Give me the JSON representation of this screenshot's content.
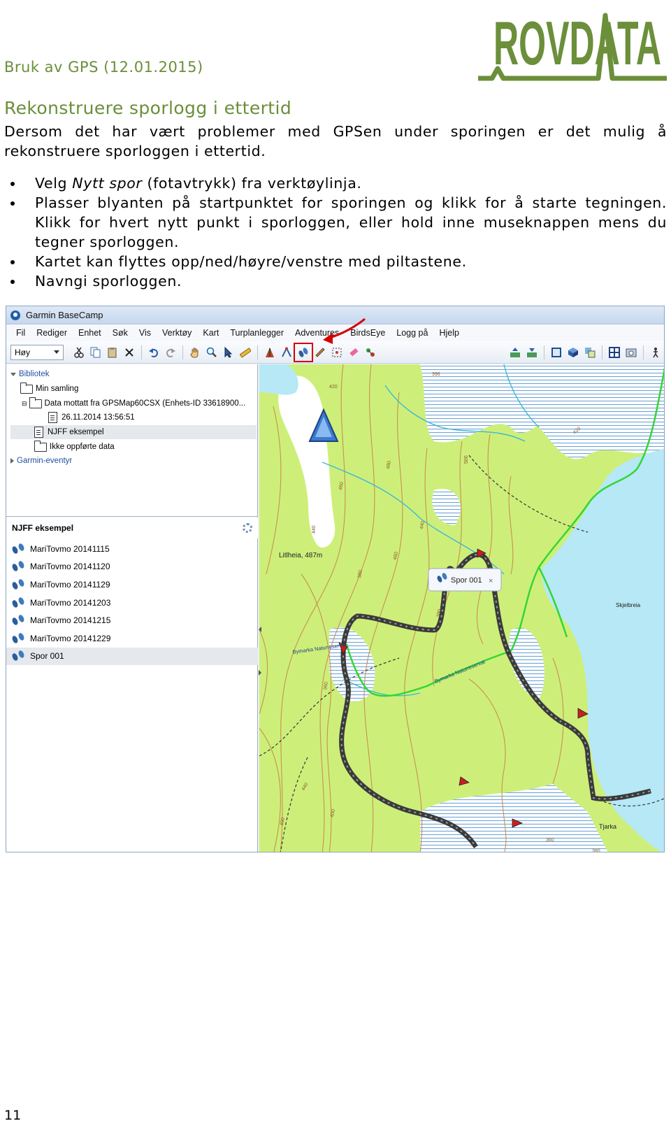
{
  "header": {
    "doc_title": "Bruk av GPS (12.01.2015)",
    "logo_text": "ROVDATA",
    "logo_color": "#6b8f3a"
  },
  "section": {
    "heading": "Rekonstruere sporlogg i ettertid",
    "intro": "Dersom det har vært problemer med GPSen under sporingen er det mulig å rekonstruere sporloggen i ettertid."
  },
  "bullets": {
    "b1_pre": "Velg ",
    "b1_em": "Nytt spor",
    "b1_post": " (fotavtrykk) fra verktøylinja.",
    "b2": "Plasser blyanten på startpunktet for sporingen og klikk for å starte tegningen. Klikk for hvert nytt punkt i sporloggen, eller hold inne museknappen mens du tegner sporloggen.",
    "b3": "Kartet kan flyttes opp/ned/høyre/venstre med piltastene.",
    "b4": "Navngi sporloggen."
  },
  "app": {
    "title": "Garmin BaseCamp",
    "menu": [
      "Fil",
      "Rediger",
      "Enhet",
      "Søk",
      "Vis",
      "Verktøy",
      "Kart",
      "Turplanlegger",
      "Adventures",
      "BirdsEye",
      "Logg på",
      "Hjelp"
    ],
    "detail_select": "Høy",
    "tree": {
      "library": "Bibliotek",
      "collection": "Min samling",
      "device_folder": "Data mottatt fra GPSMap60CSX (Enhets-ID 33618900...",
      "device_item": "26.11.2014 13:56:51",
      "list_item": "NJFF eksempel",
      "unlisted": "Ikke oppførte data",
      "adventures": "Garmin-eventyr"
    },
    "list_title": "NJFF eksempel",
    "tracks": [
      "MariTovmo 20141115",
      "MariTovmo 20141120",
      "MariTovmo 20141129",
      "MariTovmo 20141203",
      "MariTovmo 20141215",
      "MariTovmo 20141229",
      "Spor 001"
    ]
  },
  "map": {
    "peak_label": "Litlheia, 487m",
    "track_callout": "Spor 001",
    "place_label_1": "Skjelbreia",
    "place_label_2": "Tjarka",
    "boundary_label_1": "Bymarka Naturreservat",
    "boundary_label_2": "Bymarka Naturreservat",
    "contour_labels": [
      "396",
      "420",
      "440",
      "460",
      "480",
      "500",
      "420",
      "440",
      "460",
      "380",
      "380",
      "360",
      "440",
      "400",
      "400",
      "360",
      "380"
    ],
    "colors": {
      "land": "#cdef7a",
      "water": "#b6e8f5",
      "contour": "#c9864a",
      "track": "#5a5a5a",
      "boundary": "#33d633",
      "stream": "#3fb7d6"
    }
  },
  "page_number": "11"
}
